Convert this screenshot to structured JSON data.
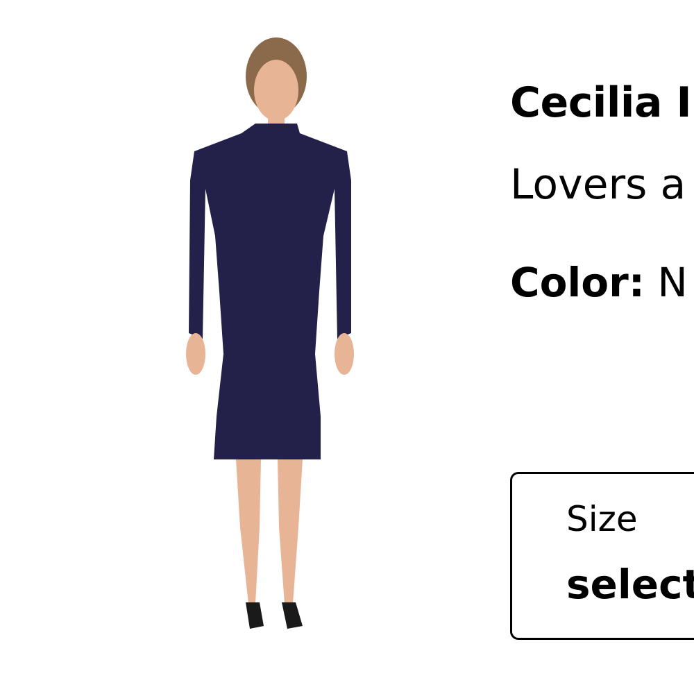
{
  "product": {
    "title": "Cecilia I",
    "brand": "Lovers a",
    "color_label": "Color:",
    "color_value": " N",
    "image_alt": "Model wearing navy long-sleeve mock-neck midi dress"
  },
  "size_selector": {
    "label": "Size",
    "value": "select"
  },
  "colors": {
    "dress": "#23204a",
    "skin": "#e8b496",
    "hair": "#8a6a4a",
    "text": "#000000",
    "border": "#000000"
  }
}
